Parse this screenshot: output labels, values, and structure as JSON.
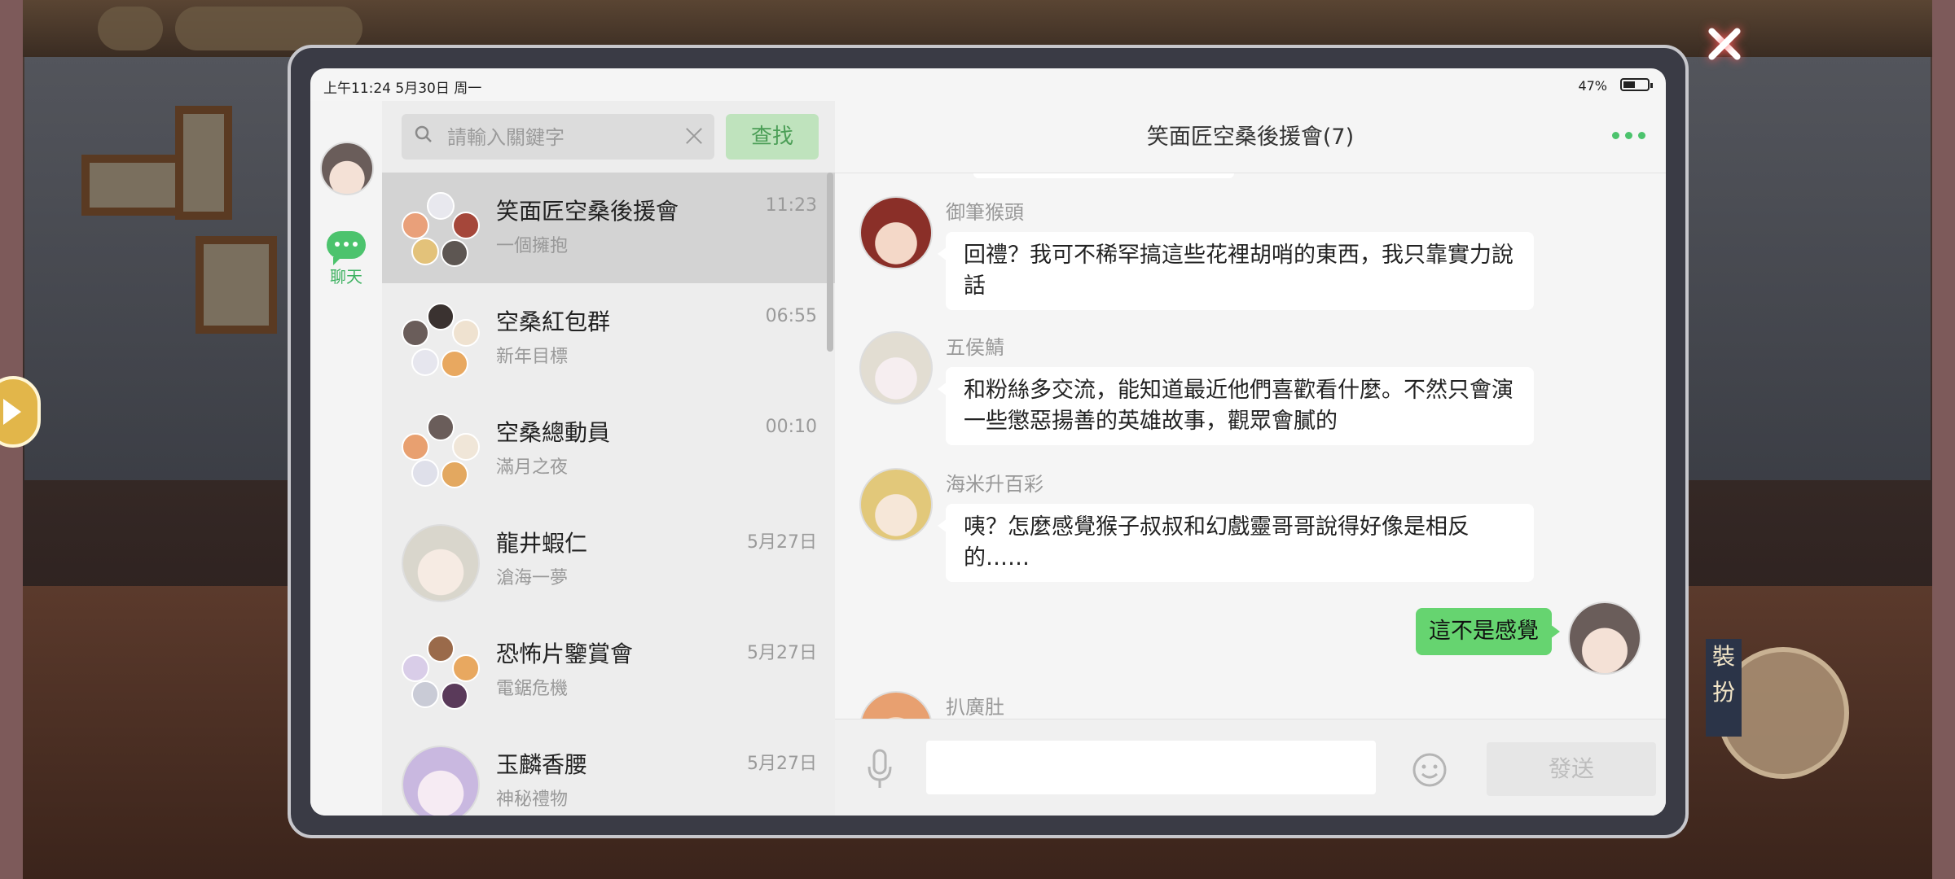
{
  "status_bar": {
    "time": "上午11:24  5月30日  周一",
    "battery": "47%"
  },
  "nav": {
    "chat_label": "聊天"
  },
  "search": {
    "placeholder": "請輸入關鍵字",
    "button": "查找"
  },
  "conversations": [
    {
      "name": "笑面匠空桑後援會",
      "preview": "一個擁抱",
      "time": "11:23",
      "type": "group",
      "active": true
    },
    {
      "name": "空桑紅包群",
      "preview": "新年目標",
      "time": "06:55",
      "type": "group"
    },
    {
      "name": "空桑總動員",
      "preview": "滿月之夜",
      "time": "00:10",
      "type": "group"
    },
    {
      "name": "龍井蝦仁",
      "preview": "滄海一夢",
      "time": "5月27日",
      "type": "single"
    },
    {
      "name": "恐怖片鑒賞會",
      "preview": "電鋸危機",
      "time": "5月27日",
      "type": "group"
    },
    {
      "name": "玉麟香腰",
      "preview": "神秘禮物",
      "time": "5月27日",
      "type": "single"
    }
  ],
  "chat": {
    "title": "笑面匠空桑後援會(7)",
    "messages": [
      {
        "sender": "御筆猴頭",
        "text": "回禮？我可不稀罕搞這些花裡胡哨的東西，我只靠實力說話"
      },
      {
        "sender": "五侯鯖",
        "text": "和粉絲多交流，能知道最近他們喜歡看什麼。不然只會演一些懲惡揚善的英雄故事，觀眾會膩的"
      },
      {
        "sender": "海米升百彩",
        "text": "咦？怎麼感覺猴子叔叔和幻戲靈哥哥說得好像是相反的……"
      },
      {
        "sender": "me",
        "text": "這不是感覺"
      },
      {
        "sender": "扒廣肚",
        "text": ""
      }
    ],
    "send_label": "發送"
  },
  "background": {
    "dress_label": "裝扮"
  },
  "colors": {
    "accent_green": "#4cc36d",
    "my_bubble": "#66d470",
    "active_row": "#d3d3d3"
  }
}
